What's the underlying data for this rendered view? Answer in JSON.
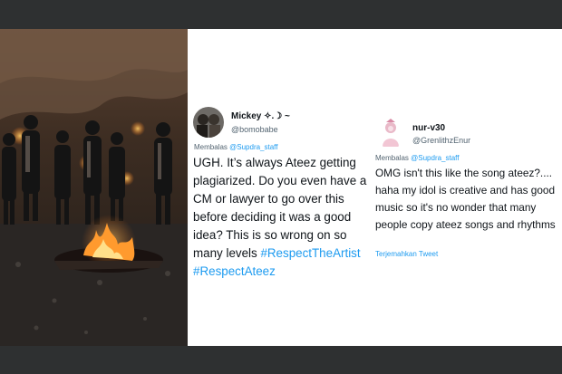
{
  "colors": {
    "background": "#2e3031",
    "card": "#ffffff",
    "text": "#0f1419",
    "muted": "#536471",
    "link": "#1d9bf0"
  },
  "photo": {
    "icon": "group-photo-in-cave-with-fires"
  },
  "tweet1": {
    "name": "Mickey ✧.☽ ~",
    "handle": "@bomobabe",
    "reply_prefix": "Membalas",
    "reply_to": "@Supdra_staff",
    "text": "UGH. It’s always Ateez getting plagiarized. Do you even have a CM or lawyer to go over this before deciding it was a good idea? This is so wrong on so many levels",
    "hashtags": [
      "#RespectTheArtist",
      "#RespectAteez"
    ]
  },
  "tweet2": {
    "name": "nur-v30",
    "handle": "@GrenlithzEnur",
    "reply_prefix": "Membalas",
    "reply_to": "@Supdra_staff",
    "text": "OMG isn't this like the song ateez?.... haha my idol is creative and has good music so it's no wonder that many people copy ateez songs and rhythms",
    "translate_label": "Terjemahkan Tweet"
  }
}
